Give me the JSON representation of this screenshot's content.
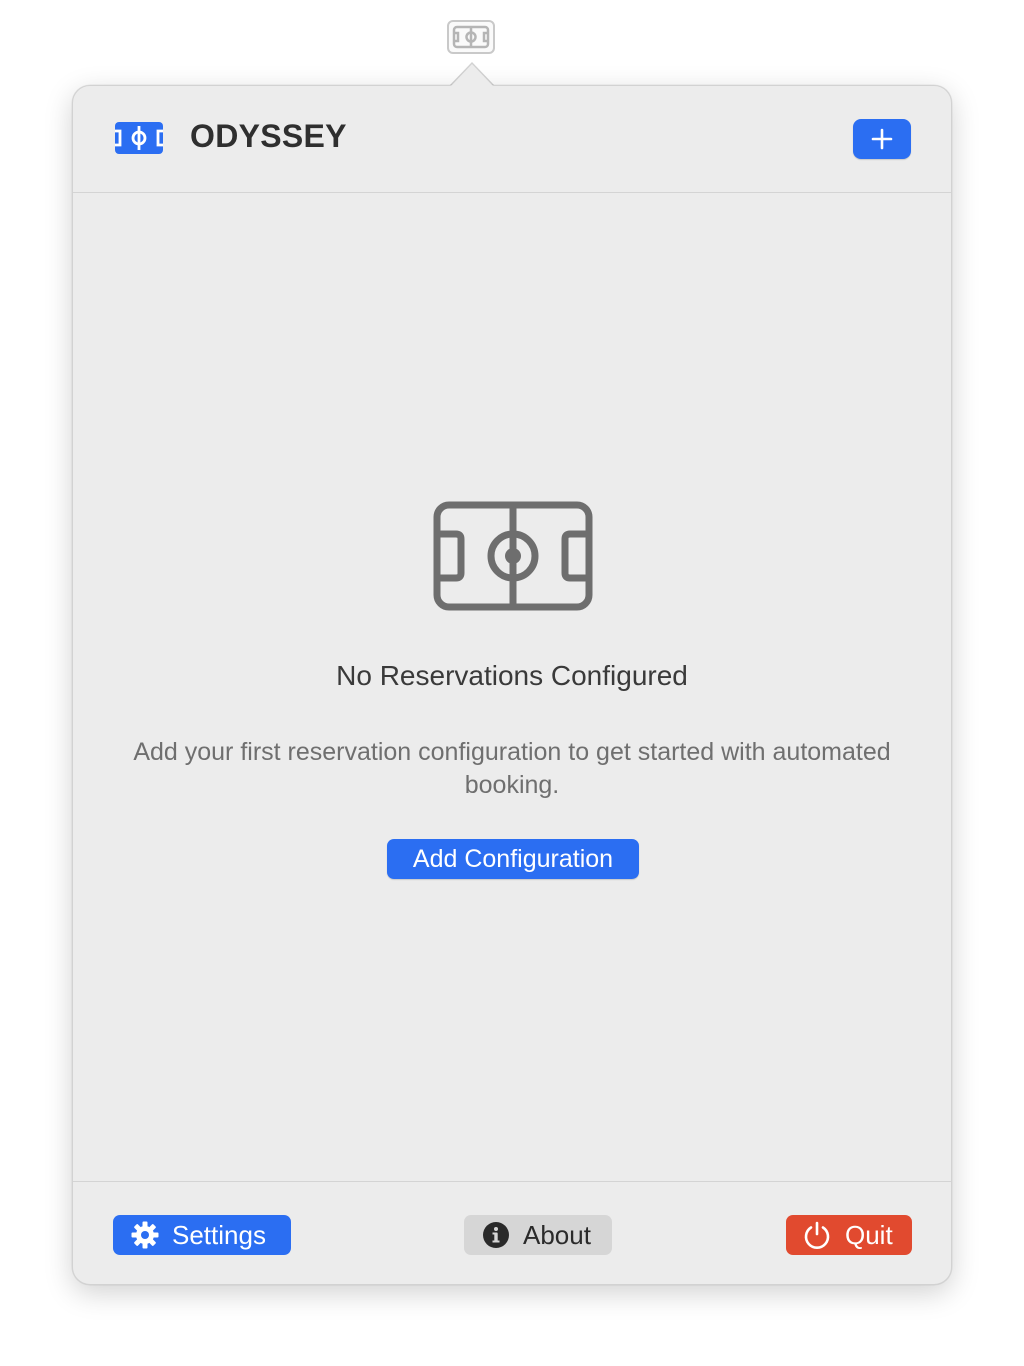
{
  "app": {
    "title": "ODYSSEY",
    "logo_icon": "soccer-field-icon",
    "accent_color": "#2b6ef2"
  },
  "menubar": {
    "icon": "soccer-field-icon"
  },
  "header": {
    "add_button_icon": "plus-icon"
  },
  "empty_state": {
    "icon": "soccer-field-icon",
    "title": "No Reservations Configured",
    "description": "Add your first reservation configuration to get started with automated booking.",
    "button_label": "Add Configuration"
  },
  "footer": {
    "settings": {
      "label": "Settings",
      "icon": "gear-icon",
      "color": "#2b6ef2"
    },
    "about": {
      "label": "About",
      "icon": "info-icon",
      "color": "#d6d6d6"
    },
    "quit": {
      "label": "Quit",
      "icon": "power-icon",
      "color": "#e14a2f"
    }
  }
}
